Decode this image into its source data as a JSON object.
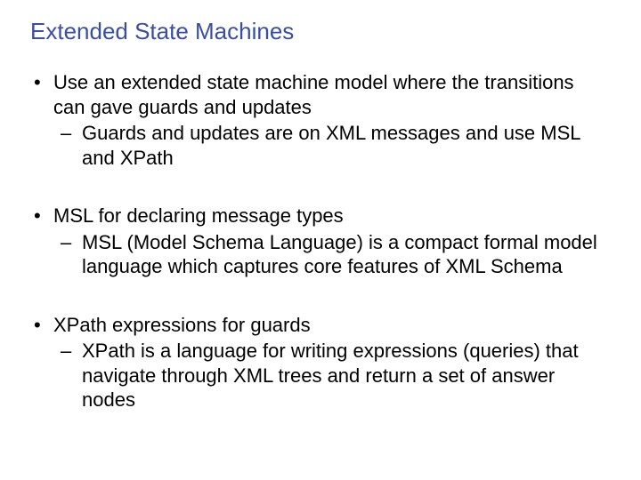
{
  "title": "Extended State Machines",
  "bullets": [
    {
      "text": "Use an extended state machine model where the transitions can gave guards and updates",
      "sub": [
        "Guards and updates are on XML messages and use MSL and XPath"
      ]
    },
    {
      "text": "MSL for declaring message types",
      "sub": [
        "MSL (Model Schema Language) is a compact formal model language which captures core features of XML Schema"
      ]
    },
    {
      "text": "XPath expressions for guards",
      "sub": [
        "XPath is a language for writing expressions (queries) that navigate through XML trees and return a set of answer nodes"
      ]
    }
  ]
}
